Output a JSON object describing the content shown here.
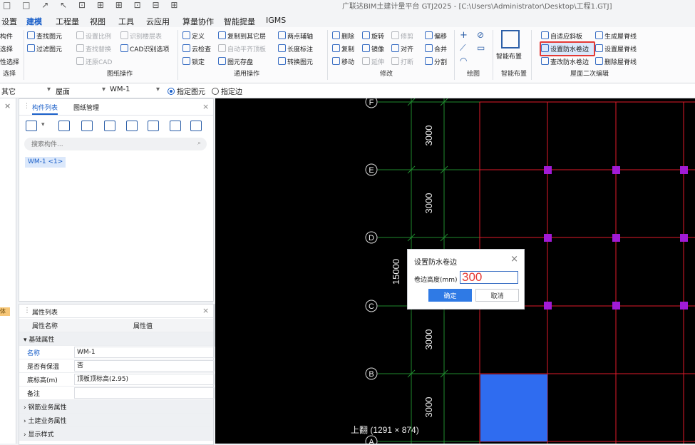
{
  "title_bar": {
    "text": "广联达BIM土建计量平台 GTJ2025 - [C:\\Users\\Administrator\\Desktop\\工程1.GTJ]"
  },
  "menu": [
    "设置",
    "建模",
    "工程量",
    "视图",
    "工具",
    "云应用",
    "算量协作",
    "智能提量",
    "IGMS"
  ],
  "ribbon": {
    "select_group": {
      "items": [
        "构件",
        "选择",
        "性选择"
      ],
      "label": "选择"
    },
    "drawing_ops": {
      "items": [
        "查找图元",
        "过滤图元",
        "设置比例",
        "查找替换",
        "还原CAD",
        "识别楼层表",
        "CAD识别选项"
      ],
      "label": "图纸操作"
    },
    "general_ops": {
      "items": [
        "定义",
        "云检查",
        "锁定",
        "复制到其它层",
        "自动平齐顶板",
        "图元存盘",
        "两点辅轴",
        "长度标注",
        "转换图元"
      ],
      "label": "通用操作"
    },
    "modify": {
      "items": [
        "删除",
        "旋转",
        "修剪",
        "偏移",
        "复制",
        "镜像",
        "对齐",
        "合并",
        "移动",
        "延伸",
        "打断",
        "分割"
      ],
      "label": "修改"
    },
    "draw": {
      "label": "绘图"
    },
    "smart": {
      "item": "智能布置",
      "label": "智能布置"
    },
    "roof": {
      "items": [
        "自适应斜板",
        "生成屋脊线",
        "设置防水卷边",
        "设置屋脊线",
        "查改防水卷边",
        "删除屋脊线"
      ],
      "label": "屋面二次编辑"
    }
  },
  "prop_bar": {
    "cat": "其它",
    "type": "屋面",
    "comp": "WM-1",
    "mode1": "指定图元",
    "mode2": "指定边"
  },
  "comp_panel": {
    "tab1": "构件列表",
    "tab2": "图纸管理",
    "search_placeholder": "搜索构件...",
    "item": "WM-1 <1>"
  },
  "left_strip": {
    "tag": "体验"
  },
  "prop_panel": {
    "title": "属性列表",
    "col1": "属性名称",
    "col2": "属性值",
    "section1": "基础属性",
    "rows": [
      {
        "k": "名称",
        "v": "WM-1"
      },
      {
        "k": "是否有保温",
        "v": "否"
      },
      {
        "k": "底标高(m)",
        "v": "顶板顶标高(2.95)"
      },
      {
        "k": "备注",
        "v": ""
      }
    ],
    "sections": [
      "钢筋业务属性",
      "土建业务属性",
      "显示样式"
    ]
  },
  "canvas": {
    "axis_labels": [
      "F",
      "E",
      "D",
      "C",
      "B",
      "A"
    ],
    "dims": [
      "3000",
      "3000",
      "3000",
      "3000"
    ],
    "total_dim": "15000",
    "status": "上翻 (1291 × 874)"
  },
  "dialog": {
    "title": "设置防水卷边",
    "label": "卷边高度(mm)",
    "value": "300",
    "ok": "确定",
    "cancel": "取消"
  },
  "colors": {
    "accent": "#1a5fc9",
    "highlight": "#e53935",
    "grid_red": "#e01a2a",
    "grid_green": "#1f8a2e",
    "magenta": "#a11bd6",
    "fill_blue": "#2f6cf0"
  }
}
